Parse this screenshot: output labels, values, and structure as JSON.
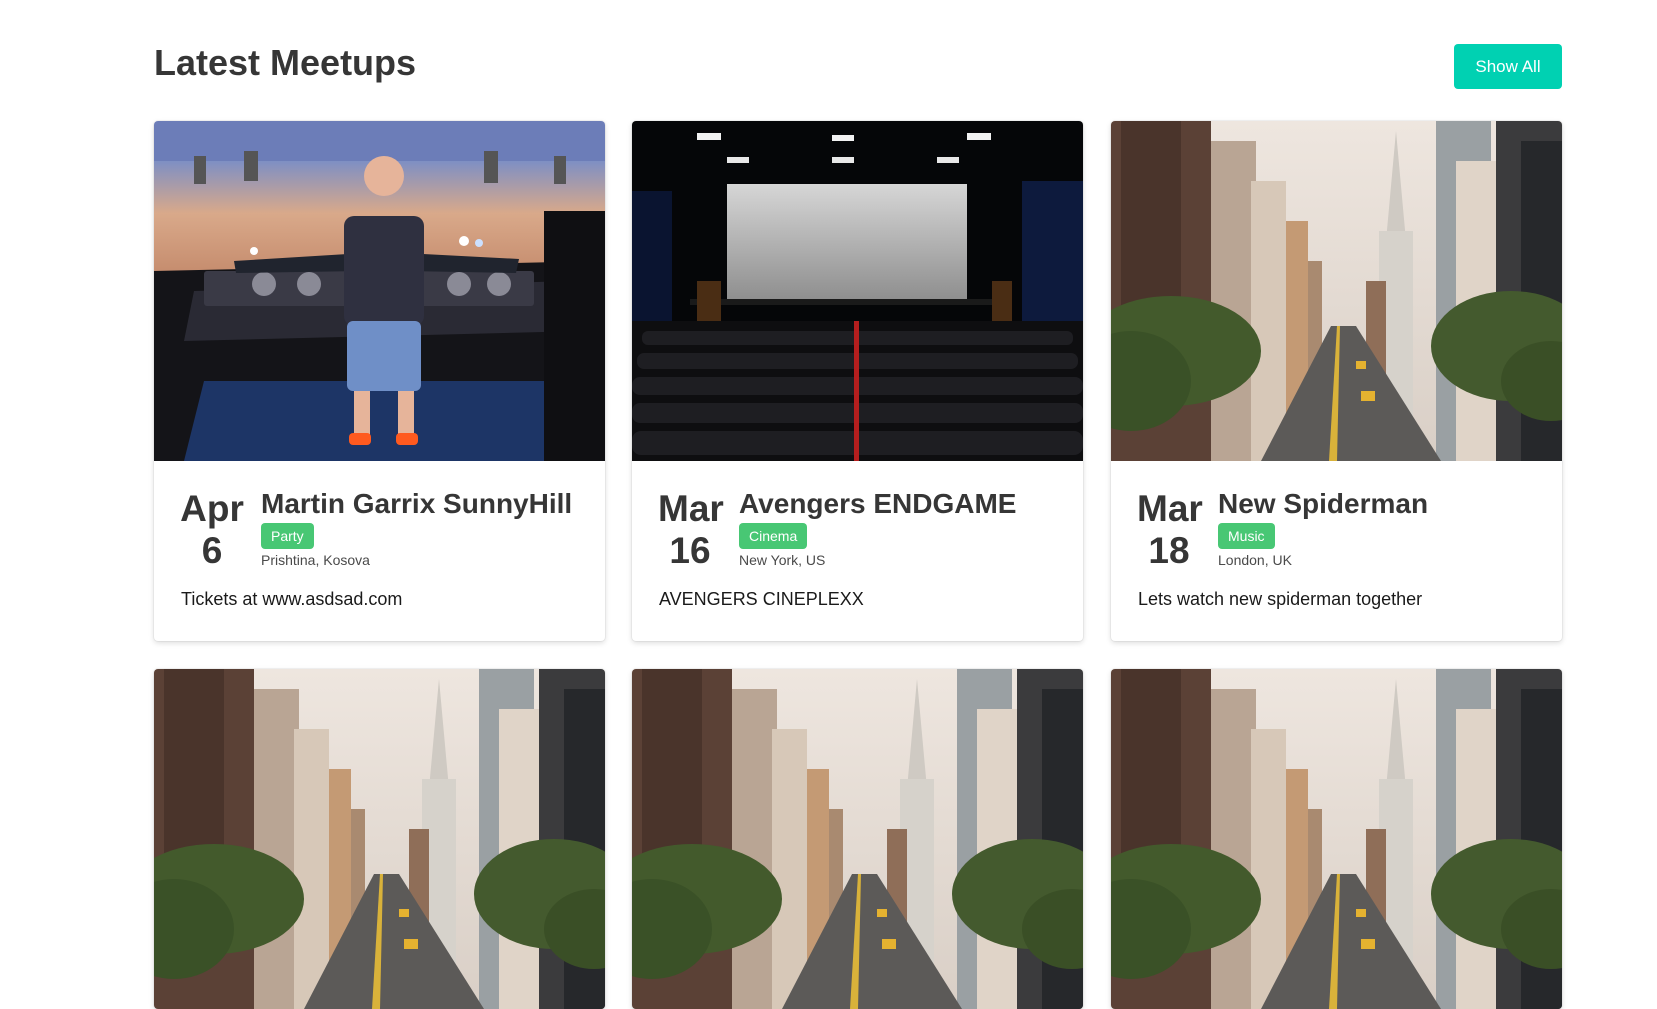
{
  "header": {
    "title": "Latest Meetups",
    "show_all_label": "Show All"
  },
  "colors": {
    "primary": "#00d1b2",
    "tag": "#48c774",
    "title": "#363636"
  },
  "meetups": [
    {
      "month": "Apr",
      "day": "6",
      "title": "Martin Garrix SunnyHill",
      "tag": "Party",
      "location": "Prishtina, Kosova",
      "description": "Tickets at www.asdsad.com",
      "image": "dj-concert-photo"
    },
    {
      "month": "Mar",
      "day": "16",
      "title": "Avengers ENDGAME",
      "tag": "Cinema",
      "location": "New York, US",
      "description": "AVENGERS CINEPLEXX",
      "image": "cinema-hall-photo"
    },
    {
      "month": "Mar",
      "day": "18",
      "title": "New Spiderman",
      "tag": "Music",
      "location": "London, UK",
      "description": "Lets watch new spiderman together",
      "image": "city-street-photo"
    },
    {
      "image": "city-street-photo"
    },
    {
      "image": "city-street-photo"
    },
    {
      "image": "city-street-photo"
    }
  ]
}
